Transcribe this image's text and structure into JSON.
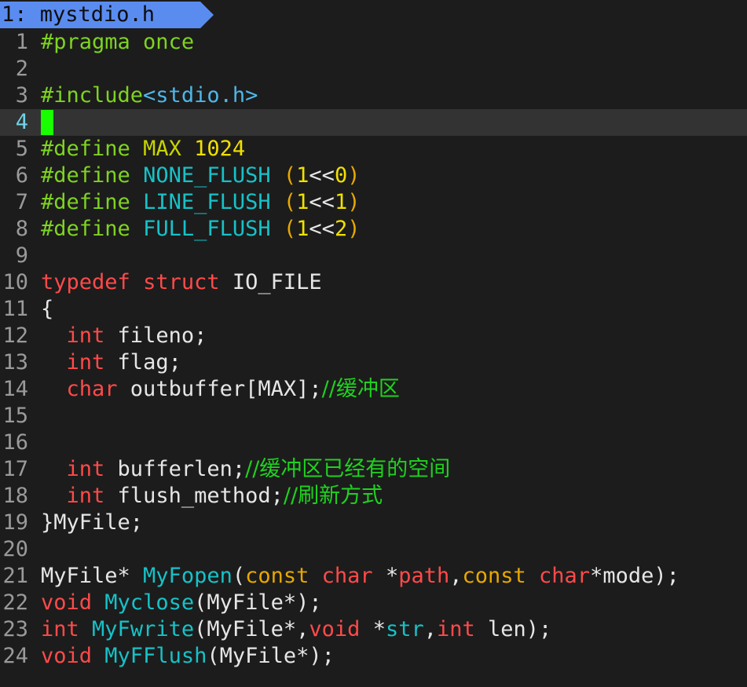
{
  "tab": {
    "label": "1: mystdio.h"
  },
  "editor": {
    "cursor_line": 4,
    "lines": [
      {
        "n": "1",
        "tokens": [
          {
            "t": "#pragma",
            "c": "pp"
          },
          {
            "t": " once",
            "c": "pp"
          }
        ]
      },
      {
        "n": "2",
        "tokens": []
      },
      {
        "n": "3",
        "tokens": [
          {
            "t": "#include",
            "c": "pp"
          },
          {
            "t": "<stdio.h>",
            "c": "str"
          }
        ]
      },
      {
        "n": "4",
        "tokens": [],
        "cursor": true
      },
      {
        "n": "5",
        "tokens": [
          {
            "t": "#define",
            "c": "pp"
          },
          {
            "t": " ",
            "c": "txt"
          },
          {
            "t": "MAX",
            "c": "macro"
          },
          {
            "t": " ",
            "c": "txt"
          },
          {
            "t": "1024",
            "c": "num"
          }
        ]
      },
      {
        "n": "6",
        "tokens": [
          {
            "t": "#define",
            "c": "pp"
          },
          {
            "t": " ",
            "c": "txt"
          },
          {
            "t": "NONE_FLUSH",
            "c": "mcyan"
          },
          {
            "t": " ",
            "c": "txt"
          },
          {
            "t": "(",
            "c": "paren"
          },
          {
            "t": "1",
            "c": "num"
          },
          {
            "t": "<<",
            "c": "txt"
          },
          {
            "t": "0",
            "c": "num"
          },
          {
            "t": ")",
            "c": "paren"
          }
        ]
      },
      {
        "n": "7",
        "tokens": [
          {
            "t": "#define",
            "c": "pp"
          },
          {
            "t": " ",
            "c": "txt"
          },
          {
            "t": "LINE_FLUSH",
            "c": "mcyan"
          },
          {
            "t": " ",
            "c": "txt"
          },
          {
            "t": "(",
            "c": "paren"
          },
          {
            "t": "1",
            "c": "num"
          },
          {
            "t": "<<",
            "c": "txt"
          },
          {
            "t": "1",
            "c": "num"
          },
          {
            "t": ")",
            "c": "paren"
          }
        ]
      },
      {
        "n": "8",
        "tokens": [
          {
            "t": "#define",
            "c": "pp"
          },
          {
            "t": " ",
            "c": "txt"
          },
          {
            "t": "FULL_FLUSH",
            "c": "mcyan"
          },
          {
            "t": " ",
            "c": "txt"
          },
          {
            "t": "(",
            "c": "paren"
          },
          {
            "t": "1",
            "c": "num"
          },
          {
            "t": "<<",
            "c": "txt"
          },
          {
            "t": "2",
            "c": "num"
          },
          {
            "t": ")",
            "c": "paren"
          }
        ]
      },
      {
        "n": "9",
        "tokens": []
      },
      {
        "n": "10",
        "tokens": [
          {
            "t": "typedef",
            "c": "kw"
          },
          {
            "t": " ",
            "c": "txt"
          },
          {
            "t": "struct",
            "c": "kw"
          },
          {
            "t": " IO_FILE",
            "c": "txt"
          }
        ]
      },
      {
        "n": "11",
        "tokens": [
          {
            "t": "{",
            "c": "txt"
          }
        ]
      },
      {
        "n": "12",
        "tokens": [
          {
            "t": "  ",
            "c": "txt"
          },
          {
            "t": "int",
            "c": "kw"
          },
          {
            "t": " fileno;",
            "c": "txt"
          }
        ]
      },
      {
        "n": "13",
        "tokens": [
          {
            "t": "  ",
            "c": "txt"
          },
          {
            "t": "int",
            "c": "kw"
          },
          {
            "t": " flag;",
            "c": "txt"
          }
        ]
      },
      {
        "n": "14",
        "tokens": [
          {
            "t": "  ",
            "c": "txt"
          },
          {
            "t": "char",
            "c": "kw"
          },
          {
            "t": " outbuffer[MAX];",
            "c": "txt"
          },
          {
            "t": "//缓冲区",
            "c": "cmt"
          }
        ]
      },
      {
        "n": "15",
        "tokens": []
      },
      {
        "n": "16",
        "tokens": []
      },
      {
        "n": "17",
        "tokens": [
          {
            "t": "  ",
            "c": "txt"
          },
          {
            "t": "int",
            "c": "kw"
          },
          {
            "t": " bufferlen;",
            "c": "txt"
          },
          {
            "t": "//缓冲区已经有的空间",
            "c": "cmt"
          }
        ]
      },
      {
        "n": "18",
        "tokens": [
          {
            "t": "  ",
            "c": "txt"
          },
          {
            "t": "int",
            "c": "kw"
          },
          {
            "t": " flush_method;",
            "c": "txt"
          },
          {
            "t": "//刷新方式",
            "c": "cmt"
          }
        ]
      },
      {
        "n": "19",
        "tokens": [
          {
            "t": "}MyFile;",
            "c": "txt"
          }
        ]
      },
      {
        "n": "20",
        "tokens": []
      },
      {
        "n": "21",
        "tokens": [
          {
            "t": "MyFile* ",
            "c": "txt"
          },
          {
            "t": "MyFopen",
            "c": "fn"
          },
          {
            "t": "(",
            "c": "txt"
          },
          {
            "t": "const",
            "c": "paren"
          },
          {
            "t": " ",
            "c": "txt"
          },
          {
            "t": "char",
            "c": "kw"
          },
          {
            "t": " *",
            "c": "txt"
          },
          {
            "t": "path",
            "c": "kw"
          },
          {
            "t": ",",
            "c": "txt"
          },
          {
            "t": "const",
            "c": "paren"
          },
          {
            "t": " ",
            "c": "txt"
          },
          {
            "t": "char",
            "c": "kw"
          },
          {
            "t": "*mode);",
            "c": "txt"
          }
        ]
      },
      {
        "n": "22",
        "tokens": [
          {
            "t": "void",
            "c": "kw"
          },
          {
            "t": " ",
            "c": "txt"
          },
          {
            "t": "Myclose",
            "c": "fn"
          },
          {
            "t": "(MyFile*);",
            "c": "txt"
          }
        ]
      },
      {
        "n": "23",
        "tokens": [
          {
            "t": "int",
            "c": "kw"
          },
          {
            "t": " ",
            "c": "txt"
          },
          {
            "t": "MyFwrite",
            "c": "fn"
          },
          {
            "t": "(MyFile*,",
            "c": "txt"
          },
          {
            "t": "void",
            "c": "kw"
          },
          {
            "t": " *",
            "c": "txt"
          },
          {
            "t": "str",
            "c": "var"
          },
          {
            "t": ",",
            "c": "txt"
          },
          {
            "t": "int",
            "c": "kw"
          },
          {
            "t": " len);",
            "c": "txt"
          }
        ]
      },
      {
        "n": "24",
        "tokens": [
          {
            "t": "void",
            "c": "kw"
          },
          {
            "t": " ",
            "c": "txt"
          },
          {
            "t": "MyFFlush",
            "c": "fn"
          },
          {
            "t": "(MyFile*);",
            "c": "txt"
          }
        ]
      }
    ]
  }
}
